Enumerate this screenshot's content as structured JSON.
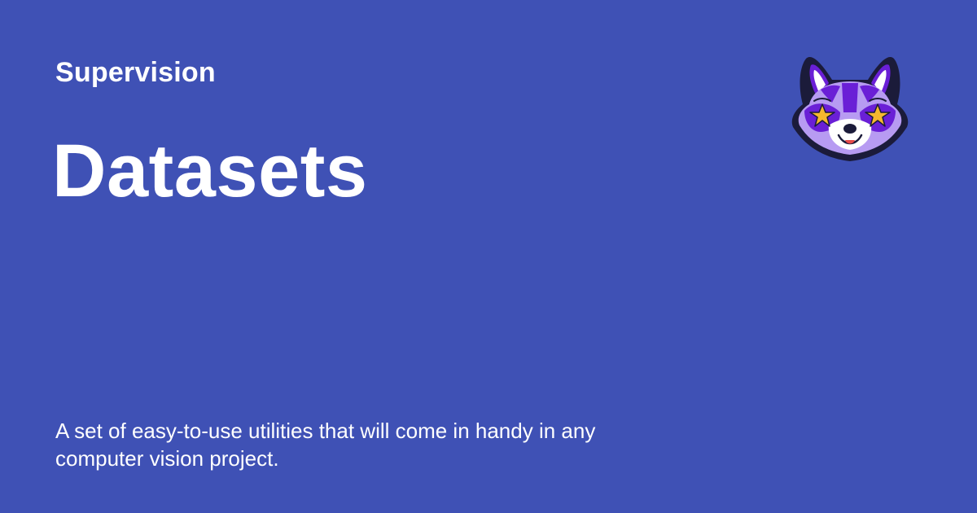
{
  "header": {
    "site_name": "Supervision"
  },
  "main": {
    "title": "Datasets",
    "description": "A set of easy-to-use utilities that will come in handy in any computer vision project."
  },
  "logo": {
    "icon": "fox-mascot-icon",
    "colors": {
      "outline": "#1b1b3a",
      "primary": "#6a1fd6",
      "secondary": "#b79bf2",
      "face": "#ffffff",
      "star": "#f5b82e"
    }
  },
  "theme": {
    "background": "#3f51b5",
    "text": "#ffffff"
  }
}
